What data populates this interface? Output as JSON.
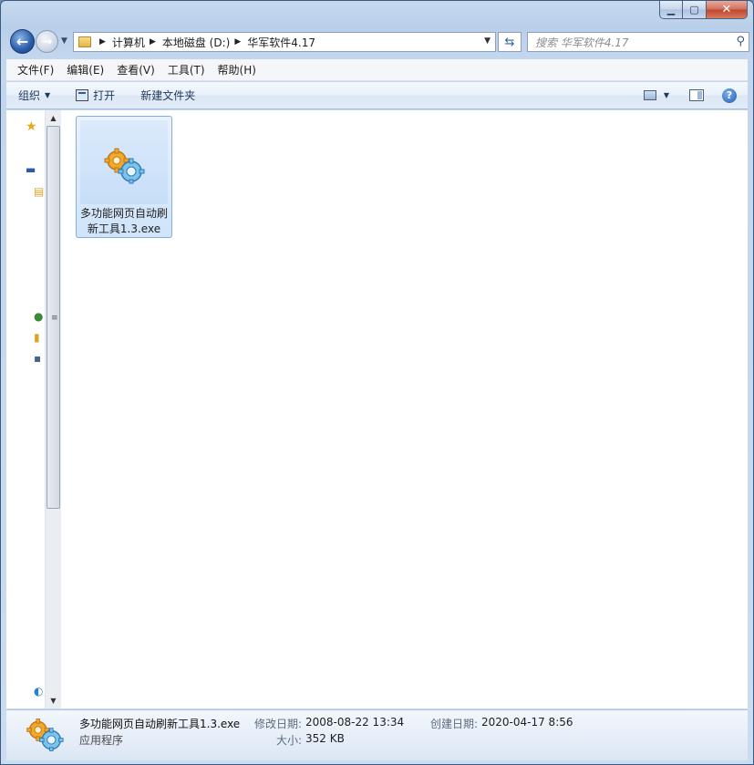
{
  "window": {
    "minimize_icon": "minimize-icon",
    "maximize_icon": "maximize-icon",
    "close_icon": "close-icon"
  },
  "address": {
    "crumbs": [
      "计算机",
      "本地磁盘 (D:)",
      "华军软件4.17"
    ]
  },
  "search": {
    "placeholder": "搜索 华军软件4.17"
  },
  "menu": {
    "file": "文件(F)",
    "edit": "编辑(E)",
    "view": "查看(V)",
    "tools": "工具(T)",
    "help": "帮助(H)"
  },
  "toolbar": {
    "organize": "组织",
    "open": "打开",
    "new_folder": "新建文件夹"
  },
  "files": [
    {
      "name": "多功能网页自动刷新工具1.3.exe",
      "icon": "gear-app-icon",
      "selected": true
    }
  ],
  "details": {
    "name": "多功能网页自动刷新工具1.3.exe",
    "type": "应用程序",
    "modified_label": "修改日期:",
    "modified_value": "2008-08-22 13:34",
    "size_label": "大小:",
    "size_value": "352 KB",
    "created_label": "创建日期:",
    "created_value": "2020-04-17 8:56"
  },
  "colors": {
    "frame": "#c2d6ee",
    "selection": "#cfe4fa",
    "selection_border": "#84acdd",
    "close_button": "#c0452c"
  }
}
